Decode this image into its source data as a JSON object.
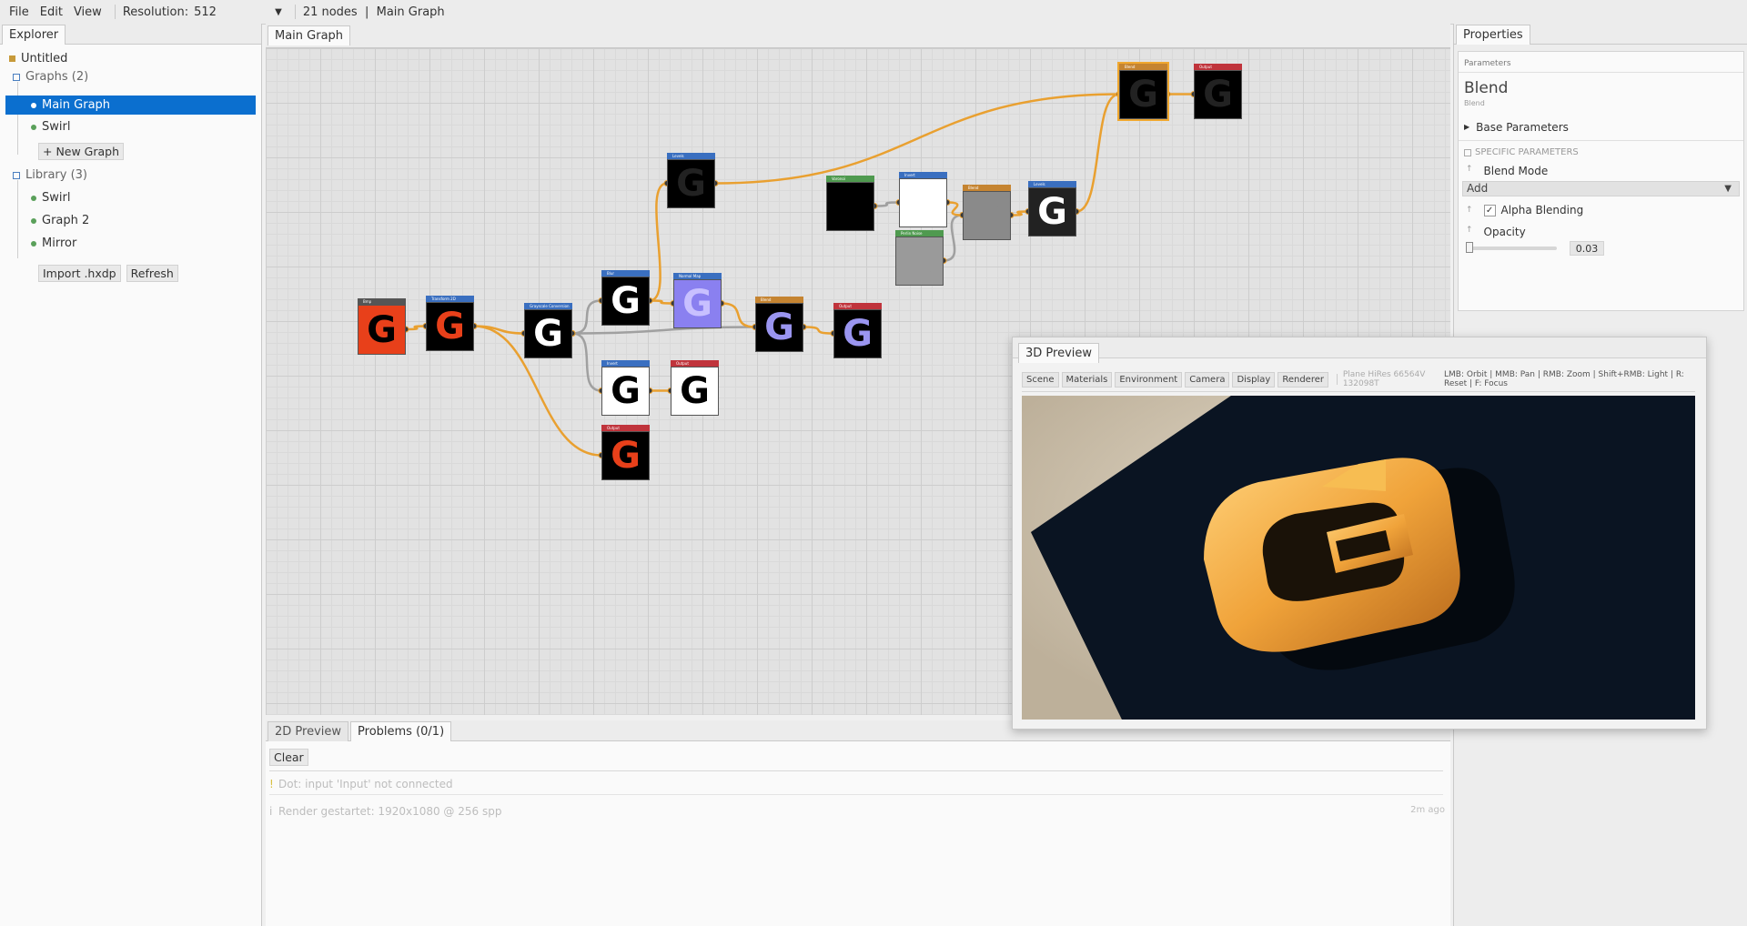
{
  "menubar": {
    "items": [
      "File",
      "Edit",
      "View"
    ],
    "resolution_label": "Resolution:",
    "resolution_value": "512",
    "status": "21 nodes  |  Main Graph"
  },
  "explorer": {
    "tab": "Explorer",
    "project": "Untitled",
    "graphs_header": "Graphs (2)",
    "graphs": [
      "Main Graph",
      "Swirl"
    ],
    "new_graph": "+ New Graph",
    "library_header": "Library (3)",
    "library": [
      "Swirl",
      "Graph 2",
      "Mirror"
    ],
    "import_button": "Import .hxdp",
    "refresh_button": "Refresh"
  },
  "graph": {
    "tab": "Main Graph",
    "nodes": [
      {
        "id": "bmp",
        "title": "Bmp",
        "header_color": "#555555",
        "bg": "#e8401a",
        "fg": "#000000"
      },
      {
        "id": "transform",
        "title": "Transform 2D",
        "header_color": "#3a6fc0",
        "bg": "#000000",
        "fg": "#e8401a"
      },
      {
        "id": "grayscale",
        "title": "Grayscale Conversion",
        "header_color": "#3a6fc0",
        "bg": "#000000",
        "fg": "#ffffff"
      },
      {
        "id": "blur",
        "title": "Blur",
        "header_color": "#3a6fc0",
        "bg": "#000000",
        "fg": "#ffffff"
      },
      {
        "id": "levels1",
        "title": "Levels",
        "header_color": "#3a6fc0",
        "bg": "#000000",
        "fg": "#222222"
      },
      {
        "id": "normalmap",
        "title": "Normal Map",
        "header_color": "#3a6fc0",
        "bg": "#8a80f0",
        "fg": "#c8c0ff"
      },
      {
        "id": "blend1",
        "title": "Blend",
        "header_color": "#c58431",
        "bg": "#000000",
        "fg": "#9a95f0"
      },
      {
        "id": "output1",
        "title": "Output",
        "header_color": "#c0343c",
        "bg": "#000000",
        "fg": "#9a95f0"
      },
      {
        "id": "invert",
        "title": "Invert",
        "header_color": "#3a6fc0",
        "bg": "#ffffff",
        "fg": "#000000"
      },
      {
        "id": "output2",
        "title": "Output",
        "header_color": "#c0343c",
        "bg": "#ffffff",
        "fg": "#000000"
      },
      {
        "id": "output3",
        "title": "Output",
        "header_color": "#c0343c",
        "bg": "#000000",
        "fg": "#e8401a"
      },
      {
        "id": "voronoi",
        "title": "Voronoi",
        "header_color": "#4f9a4f",
        "bg": "#000000",
        "fg": "#000000"
      },
      {
        "id": "invert2",
        "title": "Invert",
        "header_color": "#3a6fc0",
        "bg": "#ffffff",
        "fg": "#ffffff"
      },
      {
        "id": "perlin",
        "title": "Perlin Noise",
        "header_color": "#4f9a4f",
        "bg": "#9a9a9a",
        "fg": "#9a9a9a"
      },
      {
        "id": "blend2",
        "title": "Blend",
        "header_color": "#c58431",
        "bg": "#8a8a8a",
        "fg": "#8a8a8a"
      },
      {
        "id": "levels2",
        "title": "Levels",
        "header_color": "#3a6fc0",
        "bg": "#222222",
        "fg": "#ffffff"
      },
      {
        "id": "blend3",
        "title": "Blend",
        "header_color": "#c58431",
        "bg": "#000000",
        "fg": "#222222"
      },
      {
        "id": "output4",
        "title": "Output",
        "header_color": "#c0343c",
        "bg": "#000000",
        "fg": "#222222"
      }
    ],
    "glyph": "G",
    "wire_color": "#e9a030",
    "wire_gray": "#a0a0a0"
  },
  "bottom": {
    "tabs": [
      "2D Preview",
      "Problems (0/1)"
    ],
    "clear_button": "Clear",
    "messages": [
      {
        "icon": "!",
        "text": "Dot: input 'Input' not connected",
        "time": ""
      },
      {
        "icon": "i",
        "text": "Render gestartet: 1920x1080 @ 256 spp",
        "time": "2m ago"
      }
    ]
  },
  "properties": {
    "tab": "Properties",
    "section": "Parameters",
    "node_title": "Blend",
    "node_subtitle": "Blend",
    "base_params": "Base Parameters",
    "specific_params": "SPECIFIC PARAMETERS",
    "blend_mode_label": "Blend Mode",
    "blend_mode_value": "Add",
    "alpha_blending_label": "Alpha Blending",
    "alpha_blending_checked": true,
    "opacity_label": "Opacity",
    "opacity_value": "0.03"
  },
  "preview3d": {
    "title": "3D Preview",
    "toolbar": [
      "Scene",
      "Materials",
      "Environment",
      "Camera",
      "Display",
      "Renderer"
    ],
    "mesh_info": "Plane HiRes 66564V 132098T",
    "controls_hint": "LMB: Orbit | MMB: Pan | RMB: Zoom | Shift+RMB: Light | R: Reset | F: Focus"
  }
}
